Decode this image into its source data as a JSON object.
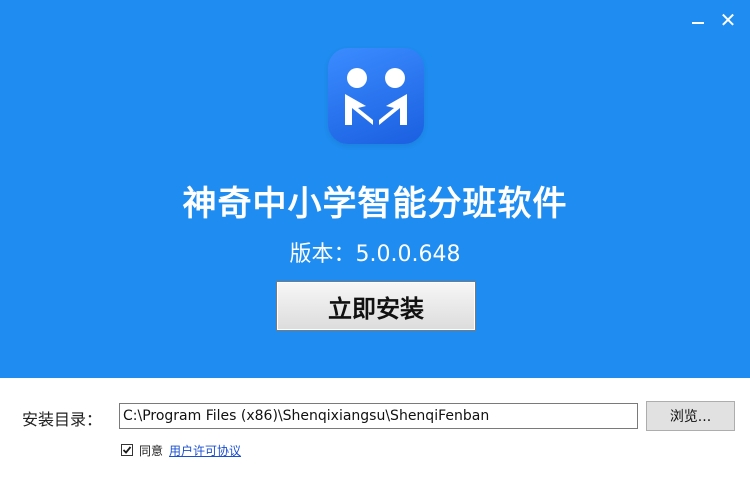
{
  "window": {
    "minimize_glyph": "−",
    "close_glyph": "✕"
  },
  "logo": {
    "icon": "app-logo-icon",
    "color": "#2a7af5"
  },
  "header": {
    "background": "#1e8cf0",
    "title": "神奇中小学智能分班软件",
    "version": "版本：5.0.0.648",
    "install_label": "立即安装"
  },
  "install_dir": {
    "label": "安装目录：",
    "value": "C:\\Program Files (x86)\\Shenqixiangsu\\ShenqiFenban",
    "browse_label": "浏览..."
  },
  "agreement": {
    "checked": true,
    "agree_text": "同意",
    "license_link": "用户许可协议"
  }
}
